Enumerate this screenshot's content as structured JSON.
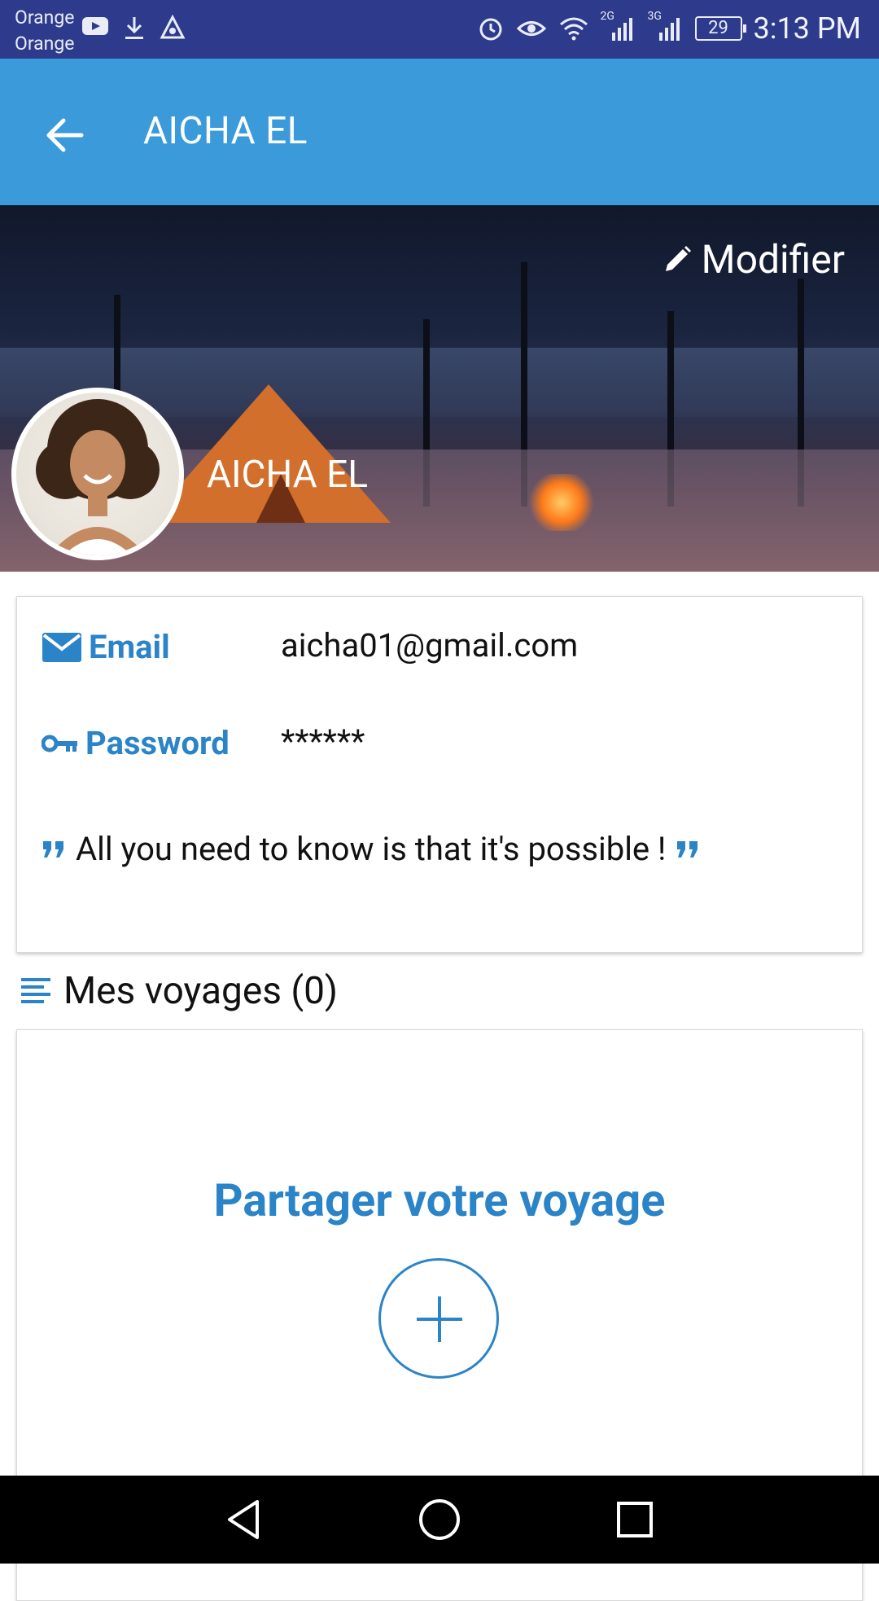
{
  "status_bar": {
    "carrier_line1": "Orange",
    "carrier_line2": "Orange",
    "network_2g": "2G",
    "network_3g": "3G",
    "battery_level": "29",
    "time": "3:13 PM",
    "icons": [
      "youtube-icon",
      "download-icon",
      "app-notification-icon",
      "alarm-icon",
      "eye-comfort-icon",
      "wifi-icon",
      "signal-2g-icon",
      "signal-3g-icon",
      "battery-icon"
    ]
  },
  "app_bar": {
    "title": "AICHA EL",
    "back_icon": "arrow-back-icon"
  },
  "profile": {
    "edit_label": "Modifier",
    "edit_icon": "pencil-icon",
    "name": "AICHA EL"
  },
  "info": {
    "email_label": "Email",
    "email_value": "aicha01@gmail.com",
    "password_label": "Password",
    "password_value": "******",
    "quote": "All you need to know is that it's possible !"
  },
  "trips": {
    "header": "Mes voyages (0)",
    "share_title": "Partager votre voyage",
    "add_icon": "plus-icon"
  },
  "colors": {
    "status_bar": "#2e3b8c",
    "app_bar": "#3a9ada",
    "accent": "#2a84c7",
    "nav_bar": "#000000"
  },
  "nav": {
    "buttons": [
      "back-triangle-icon",
      "home-circle-icon",
      "recents-square-icon"
    ]
  }
}
